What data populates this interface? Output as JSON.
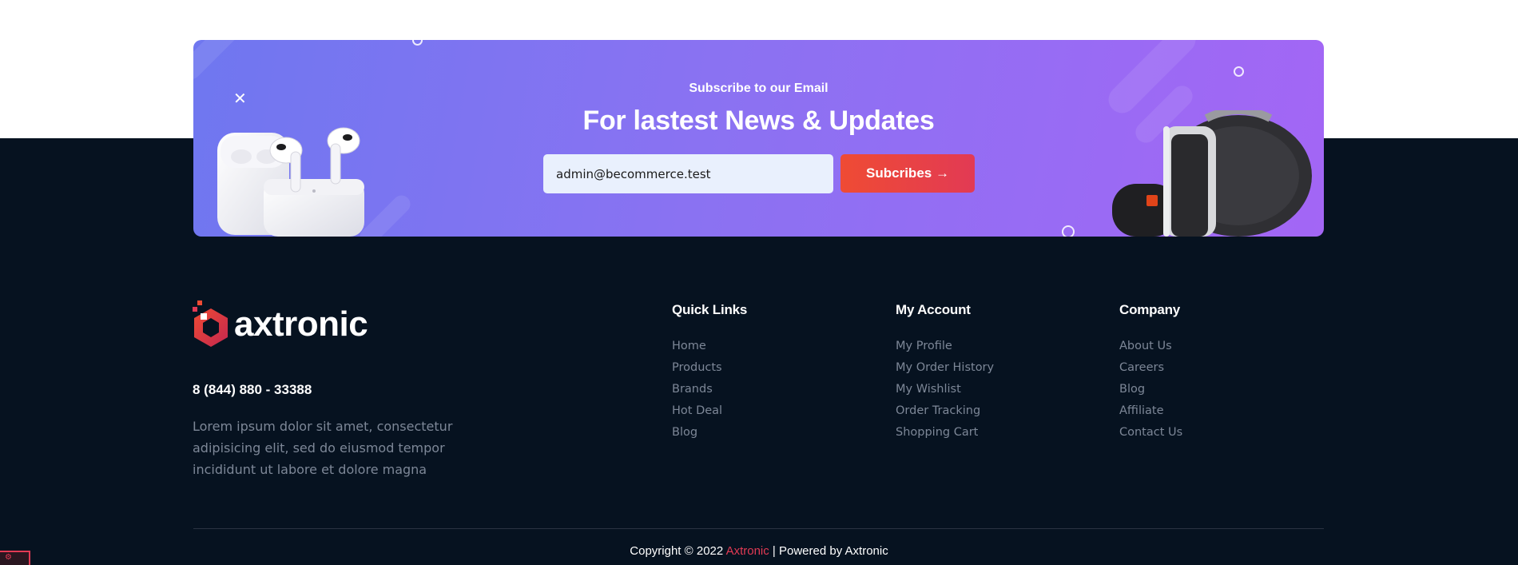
{
  "subscribe": {
    "eyebrow": "Subscribe to our Email",
    "title": "For lastest News & Updates",
    "email_value": "admin@becommerce.test",
    "button_label": "Subcribes →"
  },
  "brand": {
    "name": "axtronic",
    "phone": "8 (844) 880 - 33388",
    "description": "Lorem ipsum dolor sit amet, consectetur adipisicing elit, sed do eiusmod tempor incididunt ut labore et dolore magna"
  },
  "columns": [
    {
      "title": "Quick Links",
      "items": [
        "Home",
        "Products",
        "Brands",
        "Hot Deal",
        "Blog"
      ]
    },
    {
      "title": "My Account",
      "items": [
        "My Profile",
        "My Order History",
        "My Wishlist",
        "Order Tracking",
        "Shopping Cart"
      ]
    },
    {
      "title": "Company",
      "items": [
        "About Us",
        "Careers",
        "Blog",
        "Affiliate",
        "Contact Us"
      ]
    }
  ],
  "copyright": {
    "prefix": "Copyright © 2022",
    "brand": "Axtronic",
    "suffix": "| Powered by Axtronic"
  },
  "colors": {
    "footer_bg": "#061220",
    "accent": "#e23a54",
    "banner_start": "#6f77f0",
    "banner_end": "#a366f5"
  },
  "icons": {
    "banner_cross": "close-icon",
    "logo": "axtronic-logo-icon"
  }
}
